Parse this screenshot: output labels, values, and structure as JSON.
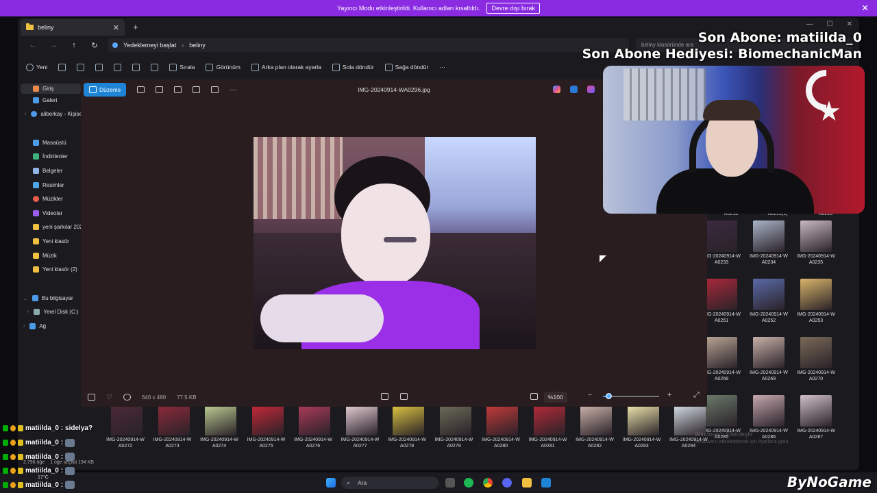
{
  "banner": {
    "message": "Yayıncı Modu etkinleştirildi. Kullanıcı adları kısaltıldı.",
    "button": "Devre dışı bırak",
    "close": "✕"
  },
  "explorer": {
    "tab_title": "beliny",
    "tab_close": "✕",
    "new_tab": "+",
    "window_controls": [
      "—",
      "☐",
      "✕"
    ],
    "nav": [
      "←",
      "→",
      "↑",
      "↻"
    ],
    "backup_label": "Yedeklemeyi başlat",
    "breadcrumb_sep": "›",
    "breadcrumb": "beliny",
    "search_placeholder": "beliny klasöründe ara",
    "commands": {
      "new": "Yeni",
      "sort": "Sırala",
      "view": "Görünüm",
      "set_background": "Arka plan olarak ayarla",
      "rotate_left": "Sola döndür",
      "rotate_right": "Sağa döndür",
      "more": "···"
    },
    "sidebar": [
      {
        "label": "Giriş",
        "icon": "home-icon",
        "color": "#e98a4c"
      },
      {
        "label": "Galeri",
        "icon": "gallery-icon",
        "color": "#4c9be9"
      },
      {
        "label": "aliberkay - Kişisel",
        "icon": "cloud-icon",
        "color": "#4c9be9"
      },
      {
        "label": "Masaüstü",
        "icon": "desktop-icon",
        "color": "#4c9be9"
      },
      {
        "label": "İndirilenler",
        "icon": "download-icon",
        "color": "#3fb37f"
      },
      {
        "label": "Belgeler",
        "icon": "documents-icon",
        "color": "#8fb4e8"
      },
      {
        "label": "Resimler",
        "icon": "pictures-icon",
        "color": "#4ca8e9"
      },
      {
        "label": "Müzikler",
        "icon": "music-icon",
        "color": "#e95c4c"
      },
      {
        "label": "Videolar",
        "icon": "videos-icon",
        "color": "#9b5ce9"
      },
      {
        "label": "yeni şarkılar 2024",
        "icon": "folder-icon",
        "color": "#f0c040"
      },
      {
        "label": "Yeni klasör",
        "icon": "folder-icon",
        "color": "#f0c040"
      },
      {
        "label": "Müzik",
        "icon": "folder-icon",
        "color": "#f0c040"
      },
      {
        "label": "Yeni klasör (2)",
        "icon": "folder-icon",
        "color": "#f0c040"
      },
      {
        "label": "Bu bilgisayar",
        "icon": "computer-icon",
        "color": "#4c9be9"
      },
      {
        "label": "Yerel Disk (C:)",
        "icon": "disk-icon",
        "color": "#8aa"
      },
      {
        "label": "Ağ",
        "icon": "network-icon",
        "color": "#4c9be9"
      }
    ],
    "status": {
      "count": "2.796 öğe",
      "selected": "1 öğe seçildi  194 KB"
    }
  },
  "viewer": {
    "edit_label": "Düzenle",
    "filename": "IMG-20240914-WA0296.jpg",
    "more": "···",
    "dimensions": "640 x 480",
    "size": "77.5 KB",
    "zoom": "%100",
    "zoom_level": 0.1
  },
  "thumbnails_right": {
    "top_row": [
      "A0218",
      "A0219(1)",
      "A0220"
    ],
    "grid": [
      [
        "IMG-20240914-W",
        "A0233"
      ],
      [
        "IMG-20240914-W",
        "A0234"
      ],
      [
        "IMG-20240914-W",
        "A0235"
      ],
      [
        "IMG-20240914-W",
        "A0251"
      ],
      [
        "IMG-20240914-W",
        "A0252"
      ],
      [
        "IMG-20240914-W",
        "A0253"
      ],
      [
        "IMG-20240914-W",
        "A0268"
      ],
      [
        "IMG-20240914-W",
        "A0269"
      ],
      [
        "IMG-20240914-W",
        "A0270"
      ],
      [
        "IMG-20240914-W",
        "A0285"
      ],
      [
        "IMG-20240914-W",
        "A0286"
      ],
      [
        "IMG-20240914-W",
        "A0287"
      ]
    ]
  },
  "thumbnails_bottom": [
    [
      "IMG-20240914-W",
      "A0272"
    ],
    [
      "IMG-20240914-W",
      "A0273"
    ],
    [
      "IMG-20240914-W",
      "A0274"
    ],
    [
      "IMG-20240914-W",
      "A0275"
    ],
    [
      "IMG-20240914-W",
      "A0276"
    ],
    [
      "IMG-20240914-W",
      "A0277"
    ],
    [
      "IMG-20240914-W",
      "A0278"
    ],
    [
      "IMG-20240914-W",
      "A0279"
    ],
    [
      "IMG-20240914-W",
      "A0280"
    ],
    [
      "IMG-20240914-W",
      "A0281"
    ],
    [
      "IMG-20240914-W",
      "A0282"
    ],
    [
      "IMG-20240914-W",
      "A0283"
    ],
    [
      "IMG-20240914-W",
      "A0284"
    ]
  ],
  "overlay": {
    "last_sub": "Son Abone: matiilda_0",
    "last_gift": "Son Abone Hediyesi: BiomechanicMan"
  },
  "chat": [
    {
      "user": "matiilda_0",
      "text": ": sidelya?"
    },
    {
      "user": "matiilda_0",
      "text": ":"
    },
    {
      "user": "matiilda_0",
      "text": ":"
    },
    {
      "user": "matiilda_0",
      "text": ":"
    },
    {
      "user": "matiilda_0",
      "text": ":"
    }
  ],
  "taskbar": {
    "search": "Ara",
    "weather": "17°C"
  },
  "watermark": {
    "line1": "Windows'u Etkinleştir",
    "line2": "Windows'u etkinleştirmek için Ayarlar'a gidin."
  },
  "brand": "ByNoGame"
}
